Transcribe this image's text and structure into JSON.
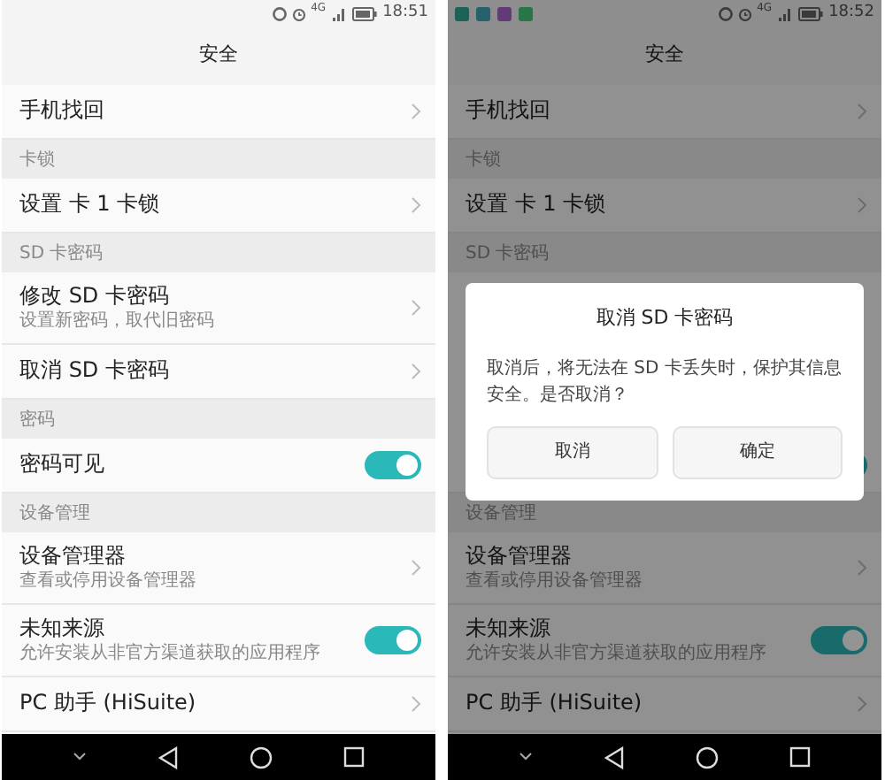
{
  "screens": [
    {
      "notifications": false,
      "network": "4G",
      "time": "18:51",
      "title": "安全",
      "items": [
        {
          "kind": "link",
          "label": "手机找回"
        },
        {
          "kind": "header",
          "label": "卡锁"
        },
        {
          "kind": "link",
          "label": "设置 卡 1 卡锁"
        },
        {
          "kind": "header",
          "label": "SD 卡密码"
        },
        {
          "kind": "link",
          "label": "修改 SD 卡密码",
          "sub": "设置新密码，取代旧密码"
        },
        {
          "kind": "link",
          "label": "取消 SD 卡密码"
        },
        {
          "kind": "header",
          "label": "密码"
        },
        {
          "kind": "toggle",
          "label": "密码可见",
          "on": true
        },
        {
          "kind": "header",
          "label": "设备管理"
        },
        {
          "kind": "link",
          "label": "设备管理器",
          "sub": "查看或停用设备管理器"
        },
        {
          "kind": "toggle",
          "label": "未知来源",
          "sub": "允许安装从非官方渠道获取的应用程序",
          "on": true
        },
        {
          "kind": "link",
          "label": "PC 助手 (HiSuite)"
        }
      ]
    },
    {
      "notifications": true,
      "network": "4G",
      "time": "18:52",
      "title": "安全",
      "items": [
        {
          "kind": "link",
          "label": "手机找回"
        },
        {
          "kind": "header",
          "label": "卡锁"
        },
        {
          "kind": "link",
          "label": "设置 卡 1 卡锁"
        },
        {
          "kind": "header",
          "label": "SD 卡密码"
        },
        {
          "kind": "covered"
        },
        {
          "kind": "toggle",
          "on": true
        },
        {
          "kind": "header",
          "label": "设备管理"
        },
        {
          "kind": "link",
          "label": "设备管理器",
          "sub": "查看或停用设备管理器"
        },
        {
          "kind": "toggle",
          "label": "未知来源",
          "sub": "允许安装从非官方渠道获取的应用程序",
          "on": true
        },
        {
          "kind": "link",
          "label": "PC 助手 (HiSuite)"
        }
      ],
      "dialog": {
        "title": "取消 SD 卡密码",
        "message": "取消后，将无法在 SD 卡丢失时，保护其信息安全。是否取消？",
        "buttons": [
          "取消",
          "确定"
        ]
      }
    }
  ]
}
